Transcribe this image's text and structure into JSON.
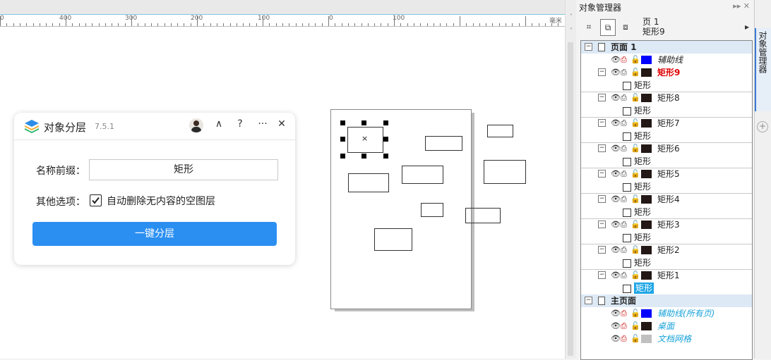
{
  "ruler": {
    "labels": [
      "0",
      "400",
      "300",
      "200",
      "100",
      "0",
      "100"
    ],
    "unit": "毫米"
  },
  "scroll": {
    "up": "˄",
    "down": "˅"
  },
  "dialog": {
    "title": "对象分层",
    "version": "7.5.1",
    "collapse": "∧",
    "help": "?",
    "more": "···",
    "close": "✕",
    "prefix_label": "名称前缀：",
    "prefix_value": "矩形",
    "options_label": "其他选项：",
    "checkbox_label": "自动删除无内容的空图层",
    "checkbox_checked": true,
    "action_button": "一键分层"
  },
  "panel": {
    "title": "对象管理器",
    "controls": "▸▸ ✕",
    "page_line1": "页 1",
    "page_line2": "矩形9",
    "side_tab": "对象管理器",
    "tree": [
      {
        "type": "page",
        "label": "页面 1"
      },
      {
        "type": "layer",
        "label": "辅助线",
        "color": "#0000ff",
        "style": "guide"
      },
      {
        "type": "layer",
        "label": "矩形9",
        "color": "#231815",
        "style": "active"
      },
      {
        "type": "child",
        "label": "矩形"
      },
      {
        "type": "layer",
        "label": "矩形8",
        "color": "#231815",
        "style": "normal"
      },
      {
        "type": "child",
        "label": "矩形"
      },
      {
        "type": "layer",
        "label": "矩形7",
        "color": "#231815",
        "style": "normal"
      },
      {
        "type": "child",
        "label": "矩形"
      },
      {
        "type": "layer",
        "label": "矩形6",
        "color": "#231815",
        "style": "normal"
      },
      {
        "type": "child",
        "label": "矩形"
      },
      {
        "type": "layer",
        "label": "矩形5",
        "color": "#231815",
        "style": "normal"
      },
      {
        "type": "child",
        "label": "矩形"
      },
      {
        "type": "layer",
        "label": "矩形4",
        "color": "#231815",
        "style": "normal"
      },
      {
        "type": "child",
        "label": "矩形"
      },
      {
        "type": "layer",
        "label": "矩形3",
        "color": "#231815",
        "style": "normal"
      },
      {
        "type": "child",
        "label": "矩形"
      },
      {
        "type": "layer",
        "label": "矩形2",
        "color": "#231815",
        "style": "normal"
      },
      {
        "type": "child",
        "label": "矩形"
      },
      {
        "type": "layer",
        "label": "矩形1",
        "color": "#231815",
        "style": "normal"
      },
      {
        "type": "child",
        "label": "矩形",
        "selected": true
      },
      {
        "type": "page",
        "label": "主页面"
      },
      {
        "type": "layer",
        "label": "辅助线(所有页)",
        "color": "#0000ff",
        "style": "master"
      },
      {
        "type": "layer",
        "label": "桌面",
        "color": "#231815",
        "style": "master"
      },
      {
        "type": "layer",
        "label": "文档网格",
        "color": "#c0c0c0",
        "style": "master"
      }
    ]
  },
  "colors": {
    "accent": "#2b8ff2",
    "guide_blue": "#0000ff",
    "active_red": "#e00000",
    "master_cyan": "#1aa3d9",
    "selection": "#1fa6e6"
  }
}
